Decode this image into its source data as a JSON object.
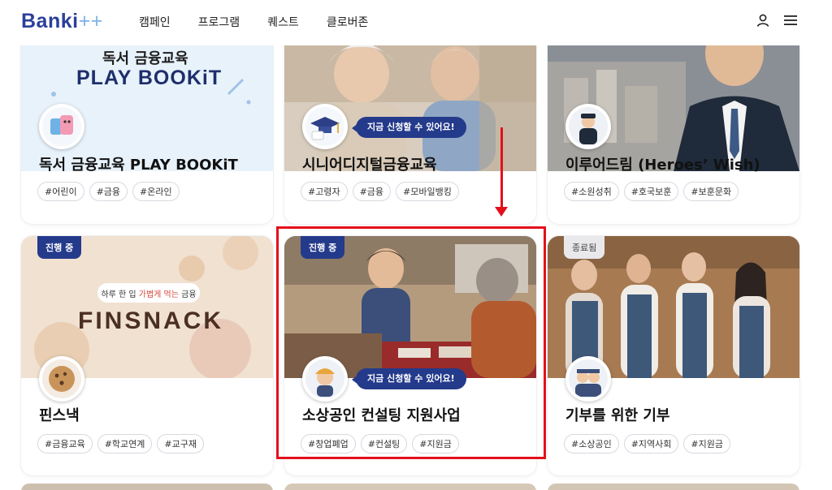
{
  "header": {
    "logo_text": "Banki",
    "logo_plus": "++",
    "nav": [
      "캠페인",
      "프로그램",
      "퀘스트",
      "클로버존"
    ],
    "icons": [
      "user-icon",
      "menu-icon"
    ]
  },
  "cards": [
    {
      "title": "독서 금융교육 PLAY BOOKiT",
      "tags": [
        "#어린이",
        "#금융",
        "#온라인"
      ],
      "hero_text_top": "독서 금융교육",
      "hero_text_bottom": "PLAY BOOKiT"
    },
    {
      "title": "시니어디지털금융교육",
      "tags": [
        "#고령자",
        "#금융",
        "#모바일뱅킹"
      ],
      "apply": "지금 신청할 수 있어요!"
    },
    {
      "title": "이루어드림 (Heroes’ Wish)",
      "tags": [
        "#소원성취",
        "#호국보훈",
        "#보훈문화"
      ]
    },
    {
      "title": "핀스낵",
      "tags": [
        "#금융교육",
        "#학교연계",
        "#교구재"
      ],
      "status": "진행 중",
      "hero_sub": "하루 한 입 가볍게 먹는 금융",
      "hero_sub_plain": "하루 한 입 ",
      "hero_sub_accent": "가볍게 먹는",
      "hero_sub_end": " 금융",
      "hero_logo": "FINSNACK"
    },
    {
      "title": "소상공인 컨설팅 지원사업",
      "tags": [
        "#창업폐업",
        "#컨설팅",
        "#지원금"
      ],
      "status": "진행 중",
      "apply": "지금 신청할 수 있어요!"
    },
    {
      "title": "기부를 위한 기부",
      "tags": [
        "#소상공인",
        "#지역사회",
        "#지원금"
      ],
      "status": "종료됨"
    }
  ],
  "colors": {
    "brand": "#243a8b",
    "highlight": "#e3101b",
    "accent_text": "#d9473d"
  }
}
